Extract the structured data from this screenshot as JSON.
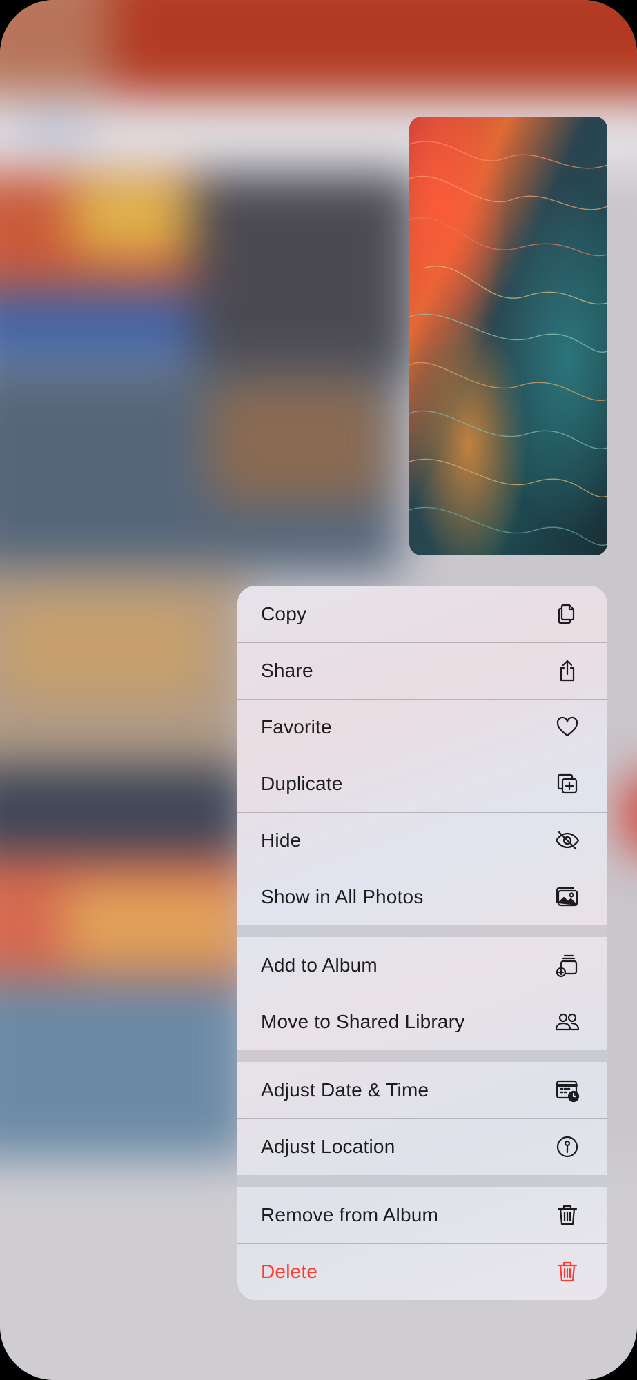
{
  "colors": {
    "destructive": "#ff3b30",
    "text": "#1c1c1e"
  },
  "menu": {
    "groups": [
      {
        "items": [
          {
            "label": "Copy",
            "icon": "copy-icon"
          },
          {
            "label": "Share",
            "icon": "share-icon"
          },
          {
            "label": "Favorite",
            "icon": "heart-icon"
          },
          {
            "label": "Duplicate",
            "icon": "duplicate-icon"
          },
          {
            "label": "Hide",
            "icon": "eye-slash-icon"
          },
          {
            "label": "Show in All Photos",
            "icon": "photos-icon"
          }
        ]
      },
      {
        "items": [
          {
            "label": "Add to Album",
            "icon": "add-to-album-icon"
          },
          {
            "label": "Move to Shared Library",
            "icon": "people-icon"
          }
        ]
      },
      {
        "items": [
          {
            "label": "Adjust Date & Time",
            "icon": "calendar-clock-icon"
          },
          {
            "label": "Adjust Location",
            "icon": "location-info-icon"
          }
        ]
      },
      {
        "items": [
          {
            "label": "Remove from Album",
            "icon": "trash-icon"
          },
          {
            "label": "Delete",
            "icon": "trash-icon",
            "destructive": true
          }
        ]
      }
    ]
  }
}
